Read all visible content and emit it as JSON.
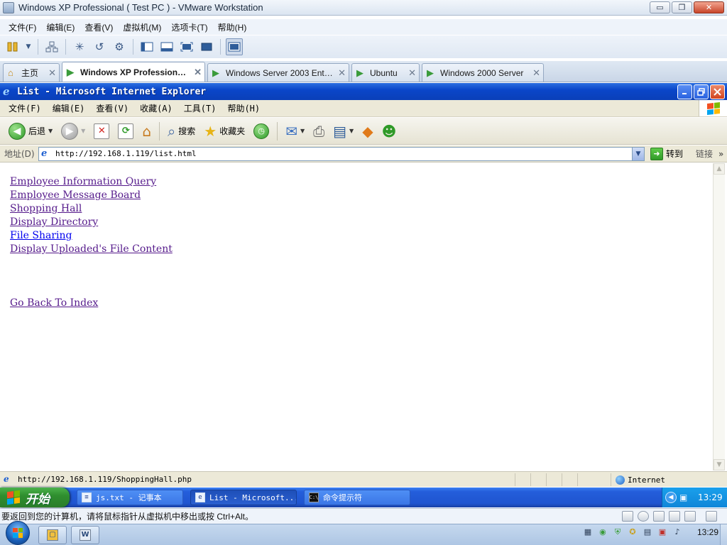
{
  "vmware": {
    "title": "Windows XP Professional ( Test PC ) - VMware Workstation",
    "window_buttons": [
      "▭",
      "❐",
      "✕"
    ],
    "menu": [
      "文件(F)",
      "编辑(E)",
      "查看(V)",
      "虚拟机(M)",
      "选项卡(T)",
      "帮助(H)"
    ],
    "tabs": [
      {
        "label": "主页",
        "icon": "home-icon",
        "active": false
      },
      {
        "label": "Windows XP Professional...",
        "icon": "vm-icon",
        "active": true
      },
      {
        "label": "Windows Server 2003 Enterpr...",
        "icon": "vm-icon",
        "active": false
      },
      {
        "label": "Ubuntu",
        "icon": "vm-icon",
        "active": false
      },
      {
        "label": "Windows 2000 Server",
        "icon": "vm-icon",
        "active": false
      }
    ],
    "tab_close": "✕",
    "status_message": "要返回到您的计算机，请将鼠标指针从虚拟机中移出或按 Ctrl+Alt。"
  },
  "ie": {
    "title": "List - Microsoft Internet Explorer",
    "menu": [
      "文件(F)",
      "编辑(E)",
      "查看(V)",
      "收藏(A)",
      "工具(T)",
      "帮助(H)"
    ],
    "toolbar": {
      "back": "后退",
      "search": "搜索",
      "favorites": "收藏夹"
    },
    "address": {
      "label": "地址(D)",
      "url": "http://192.168.1.119/list.html",
      "go": "转到",
      "links": "链接"
    },
    "status": {
      "text": "http://192.168.1.119/ShoppingHall.php",
      "zone": "Internet"
    }
  },
  "page": {
    "links": [
      {
        "text": "Employee Information Query",
        "visited": true
      },
      {
        "text": "Employee Message Board",
        "visited": true
      },
      {
        "text": "Shopping Hall",
        "visited": true
      },
      {
        "text": "Display Directory",
        "visited": true
      },
      {
        "text": "File Sharing",
        "visited": false
      },
      {
        "text": "Display Uploaded's File Content",
        "visited": true
      }
    ],
    "back_link": "Go Back To Index"
  },
  "xp_taskbar": {
    "start": "开始",
    "tasks": [
      {
        "label": "js.txt - 记事本",
        "icon": "notepad-icon",
        "active": false
      },
      {
        "label": "List - Microsoft...",
        "icon": "ie-icon",
        "active": true
      },
      {
        "label": "命令提示符",
        "icon": "cmd-icon",
        "active": false
      }
    ],
    "clock": "13:29"
  },
  "win7_taskbar": {
    "clock": "13:29"
  },
  "colors": {
    "visited_link": "#551a8b",
    "unvisited_link": "#0000ee",
    "ie_title_blue": "#0a46c9",
    "xp_taskbar_blue": "#245edb",
    "xp_start_green": "#2f8f2f"
  }
}
